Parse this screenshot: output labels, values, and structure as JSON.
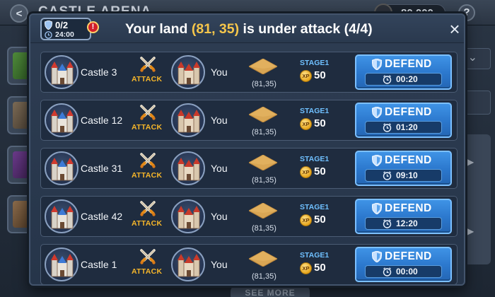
{
  "background": {
    "screen_title": "CASTLE ARENA",
    "gold_amount": "80,000",
    "help_label": "?",
    "back_label": "<",
    "see_more_label": "SEE MORE"
  },
  "header": {
    "shield_count": "0/2",
    "shield_timer": "24:00",
    "alert_label": "!",
    "title_prefix": "Your land",
    "title_coords": "(81, 35)",
    "title_suffix": "is under attack (4/4)",
    "close_label": "×"
  },
  "rows": [
    {
      "attacker": "Castle 3",
      "attack_label": "ATTACK",
      "defender": "You",
      "land": "(81,35)",
      "stage": "STAGE1",
      "xp_label": "XP",
      "xp": "50",
      "defend_label": "DEFEND",
      "timer": "00:20"
    },
    {
      "attacker": "Castle 12",
      "attack_label": "ATTACK",
      "defender": "You",
      "land": "(81,35)",
      "stage": "STAGE1",
      "xp_label": "XP",
      "xp": "50",
      "defend_label": "DEFEND",
      "timer": "01:20"
    },
    {
      "attacker": "Castle 31",
      "attack_label": "ATTACK",
      "defender": "You",
      "land": "(81,35)",
      "stage": "STAGE1",
      "xp_label": "XP",
      "xp": "50",
      "defend_label": "DEFEND",
      "timer": "09:10"
    },
    {
      "attacker": "Castle 42",
      "attack_label": "ATTACK",
      "defender": "You",
      "land": "(81,35)",
      "stage": "STAGE1",
      "xp_label": "XP",
      "xp": "50",
      "defend_label": "DEFEND",
      "timer": "12:20"
    },
    {
      "attacker": "Castle 1",
      "attack_label": "ATTACK",
      "defender": "You",
      "land": "(81,35)",
      "stage": "STAGE1",
      "xp_label": "XP",
      "xp": "50",
      "defend_label": "DEFEND",
      "timer": "00:00"
    }
  ],
  "colors": {
    "accent_gold": "#f6c64b",
    "attack_orange": "#f6b62a",
    "stage_blue": "#6fc0ff",
    "defend_blue": "#2b77cc"
  }
}
